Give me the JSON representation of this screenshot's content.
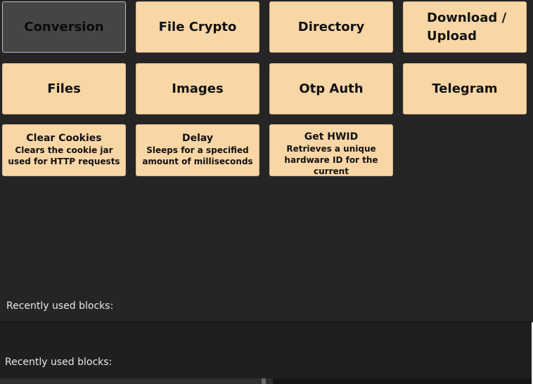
{
  "categories": [
    {
      "label": "Conversion",
      "selected": true
    },
    {
      "label": "File Crypto"
    },
    {
      "label": "Directory"
    },
    {
      "label": "Download / Upload"
    },
    {
      "label": "Files"
    },
    {
      "label": "Images"
    },
    {
      "label": "Otp Auth"
    },
    {
      "label": "Telegram"
    }
  ],
  "blocks": [
    {
      "title": "Clear Cookies",
      "description": "Clears the cookie jar used for HTTP requests"
    },
    {
      "title": "Delay",
      "description": "Sleeps for a specified amount of milliseconds"
    },
    {
      "title": "Get HWID",
      "description": "Retrieves a unique hardware ID for the current"
    }
  ],
  "recent_panels": [
    {
      "label": "Recently used blocks:"
    },
    {
      "label": "Recently used blocks:"
    }
  ],
  "colors": {
    "tile": "#f9d6a6",
    "tile_selected": "#454545",
    "background": "#252525"
  }
}
